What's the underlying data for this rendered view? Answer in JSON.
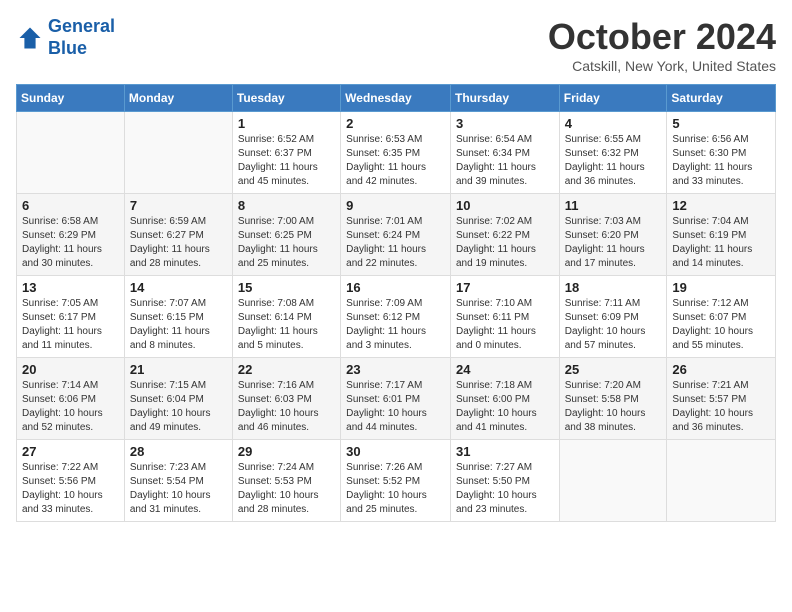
{
  "header": {
    "logo_line1": "General",
    "logo_line2": "Blue",
    "month": "October 2024",
    "location": "Catskill, New York, United States"
  },
  "days_of_week": [
    "Sunday",
    "Monday",
    "Tuesday",
    "Wednesday",
    "Thursday",
    "Friday",
    "Saturday"
  ],
  "weeks": [
    [
      {
        "day": "",
        "info": ""
      },
      {
        "day": "",
        "info": ""
      },
      {
        "day": "1",
        "info": "Sunrise: 6:52 AM\nSunset: 6:37 PM\nDaylight: 11 hours and 45 minutes."
      },
      {
        "day": "2",
        "info": "Sunrise: 6:53 AM\nSunset: 6:35 PM\nDaylight: 11 hours and 42 minutes."
      },
      {
        "day": "3",
        "info": "Sunrise: 6:54 AM\nSunset: 6:34 PM\nDaylight: 11 hours and 39 minutes."
      },
      {
        "day": "4",
        "info": "Sunrise: 6:55 AM\nSunset: 6:32 PM\nDaylight: 11 hours and 36 minutes."
      },
      {
        "day": "5",
        "info": "Sunrise: 6:56 AM\nSunset: 6:30 PM\nDaylight: 11 hours and 33 minutes."
      }
    ],
    [
      {
        "day": "6",
        "info": "Sunrise: 6:58 AM\nSunset: 6:29 PM\nDaylight: 11 hours and 30 minutes."
      },
      {
        "day": "7",
        "info": "Sunrise: 6:59 AM\nSunset: 6:27 PM\nDaylight: 11 hours and 28 minutes."
      },
      {
        "day": "8",
        "info": "Sunrise: 7:00 AM\nSunset: 6:25 PM\nDaylight: 11 hours and 25 minutes."
      },
      {
        "day": "9",
        "info": "Sunrise: 7:01 AM\nSunset: 6:24 PM\nDaylight: 11 hours and 22 minutes."
      },
      {
        "day": "10",
        "info": "Sunrise: 7:02 AM\nSunset: 6:22 PM\nDaylight: 11 hours and 19 minutes."
      },
      {
        "day": "11",
        "info": "Sunrise: 7:03 AM\nSunset: 6:20 PM\nDaylight: 11 hours and 17 minutes."
      },
      {
        "day": "12",
        "info": "Sunrise: 7:04 AM\nSunset: 6:19 PM\nDaylight: 11 hours and 14 minutes."
      }
    ],
    [
      {
        "day": "13",
        "info": "Sunrise: 7:05 AM\nSunset: 6:17 PM\nDaylight: 11 hours and 11 minutes."
      },
      {
        "day": "14",
        "info": "Sunrise: 7:07 AM\nSunset: 6:15 PM\nDaylight: 11 hours and 8 minutes."
      },
      {
        "day": "15",
        "info": "Sunrise: 7:08 AM\nSunset: 6:14 PM\nDaylight: 11 hours and 5 minutes."
      },
      {
        "day": "16",
        "info": "Sunrise: 7:09 AM\nSunset: 6:12 PM\nDaylight: 11 hours and 3 minutes."
      },
      {
        "day": "17",
        "info": "Sunrise: 7:10 AM\nSunset: 6:11 PM\nDaylight: 11 hours and 0 minutes."
      },
      {
        "day": "18",
        "info": "Sunrise: 7:11 AM\nSunset: 6:09 PM\nDaylight: 10 hours and 57 minutes."
      },
      {
        "day": "19",
        "info": "Sunrise: 7:12 AM\nSunset: 6:07 PM\nDaylight: 10 hours and 55 minutes."
      }
    ],
    [
      {
        "day": "20",
        "info": "Sunrise: 7:14 AM\nSunset: 6:06 PM\nDaylight: 10 hours and 52 minutes."
      },
      {
        "day": "21",
        "info": "Sunrise: 7:15 AM\nSunset: 6:04 PM\nDaylight: 10 hours and 49 minutes."
      },
      {
        "day": "22",
        "info": "Sunrise: 7:16 AM\nSunset: 6:03 PM\nDaylight: 10 hours and 46 minutes."
      },
      {
        "day": "23",
        "info": "Sunrise: 7:17 AM\nSunset: 6:01 PM\nDaylight: 10 hours and 44 minutes."
      },
      {
        "day": "24",
        "info": "Sunrise: 7:18 AM\nSunset: 6:00 PM\nDaylight: 10 hours and 41 minutes."
      },
      {
        "day": "25",
        "info": "Sunrise: 7:20 AM\nSunset: 5:58 PM\nDaylight: 10 hours and 38 minutes."
      },
      {
        "day": "26",
        "info": "Sunrise: 7:21 AM\nSunset: 5:57 PM\nDaylight: 10 hours and 36 minutes."
      }
    ],
    [
      {
        "day": "27",
        "info": "Sunrise: 7:22 AM\nSunset: 5:56 PM\nDaylight: 10 hours and 33 minutes."
      },
      {
        "day": "28",
        "info": "Sunrise: 7:23 AM\nSunset: 5:54 PM\nDaylight: 10 hours and 31 minutes."
      },
      {
        "day": "29",
        "info": "Sunrise: 7:24 AM\nSunset: 5:53 PM\nDaylight: 10 hours and 28 minutes."
      },
      {
        "day": "30",
        "info": "Sunrise: 7:26 AM\nSunset: 5:52 PM\nDaylight: 10 hours and 25 minutes."
      },
      {
        "day": "31",
        "info": "Sunrise: 7:27 AM\nSunset: 5:50 PM\nDaylight: 10 hours and 23 minutes."
      },
      {
        "day": "",
        "info": ""
      },
      {
        "day": "",
        "info": ""
      }
    ]
  ]
}
